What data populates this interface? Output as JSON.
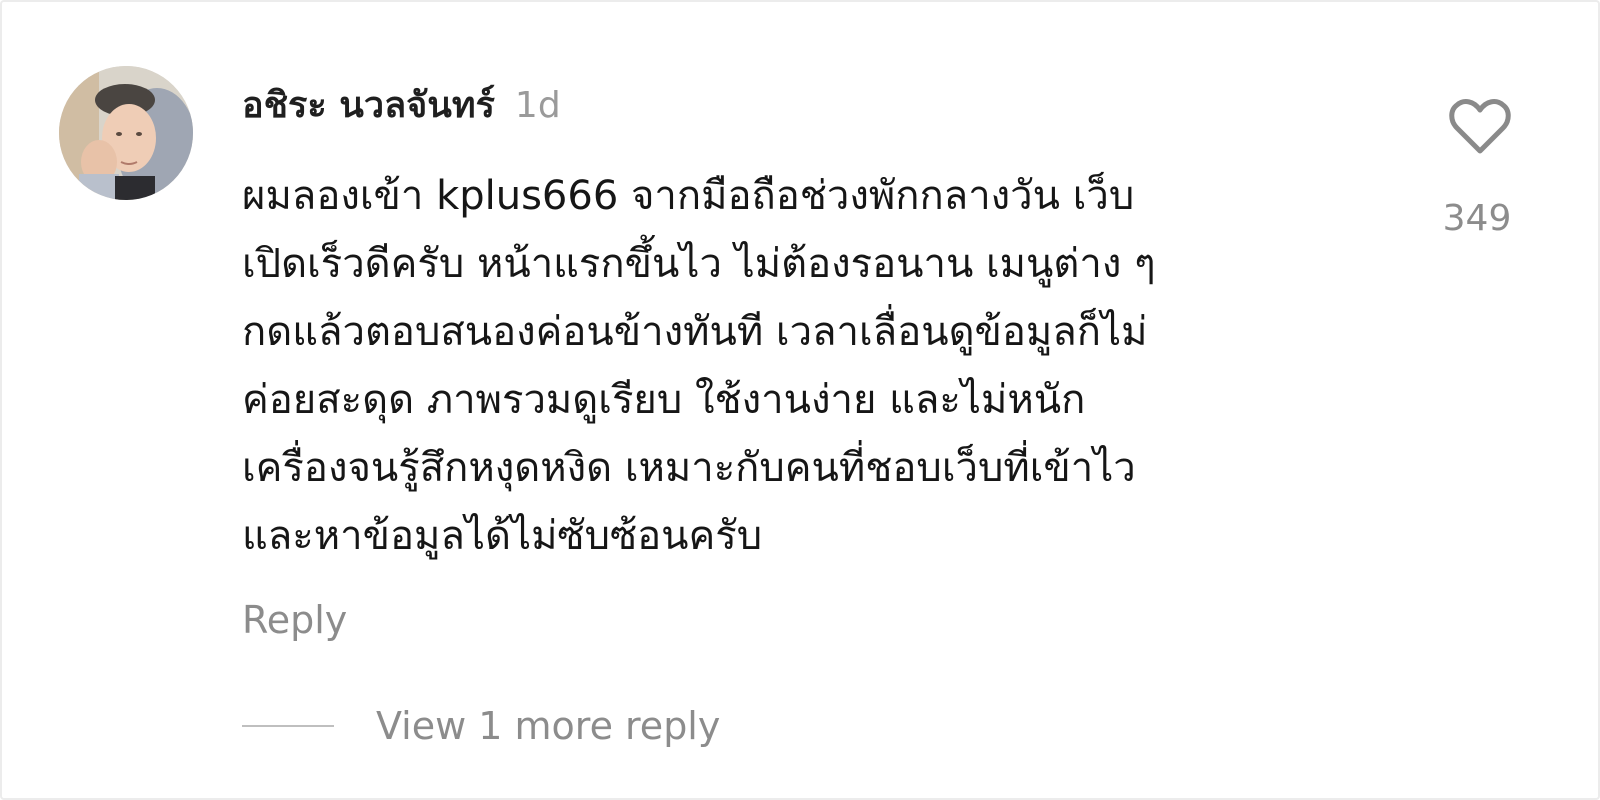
{
  "comment": {
    "author": "อชิระ นวลจันทร์",
    "time": "1d",
    "text_lines": [
      "ผมลองเข้า kplus666 จากมือถือช่วงพักกลางวัน เว็บ",
      "เปิดเร็วดีครับ หน้าแรกขึ้นไว ไม่ต้องรอนาน เมนูต่าง ๆ",
      "กดแล้วตอบสนองค่อนข้างทันที เวลาเลื่อนดูข้อมูลก็ไม่",
      "ค่อยสะดุด ภาพรวมดูเรียบ ใช้งานง่าย และไม่หนัก",
      "เครื่องจนรู้สึกหงุดหงิด เหมาะกับคนที่ชอบเว็บที่เข้าไว",
      "และหาข้อมูลได้ไม่ซับซ้อนครับ"
    ],
    "like_count": "349",
    "reply_label": "Reply",
    "view_replies_label": "View 1 more reply"
  },
  "icons": {
    "like": "heart-outline-icon",
    "avatar": "user-avatar"
  },
  "colors": {
    "primary_text": "#161616",
    "secondary_text": "#8c8c8c",
    "divider": "#bfbfbf"
  }
}
